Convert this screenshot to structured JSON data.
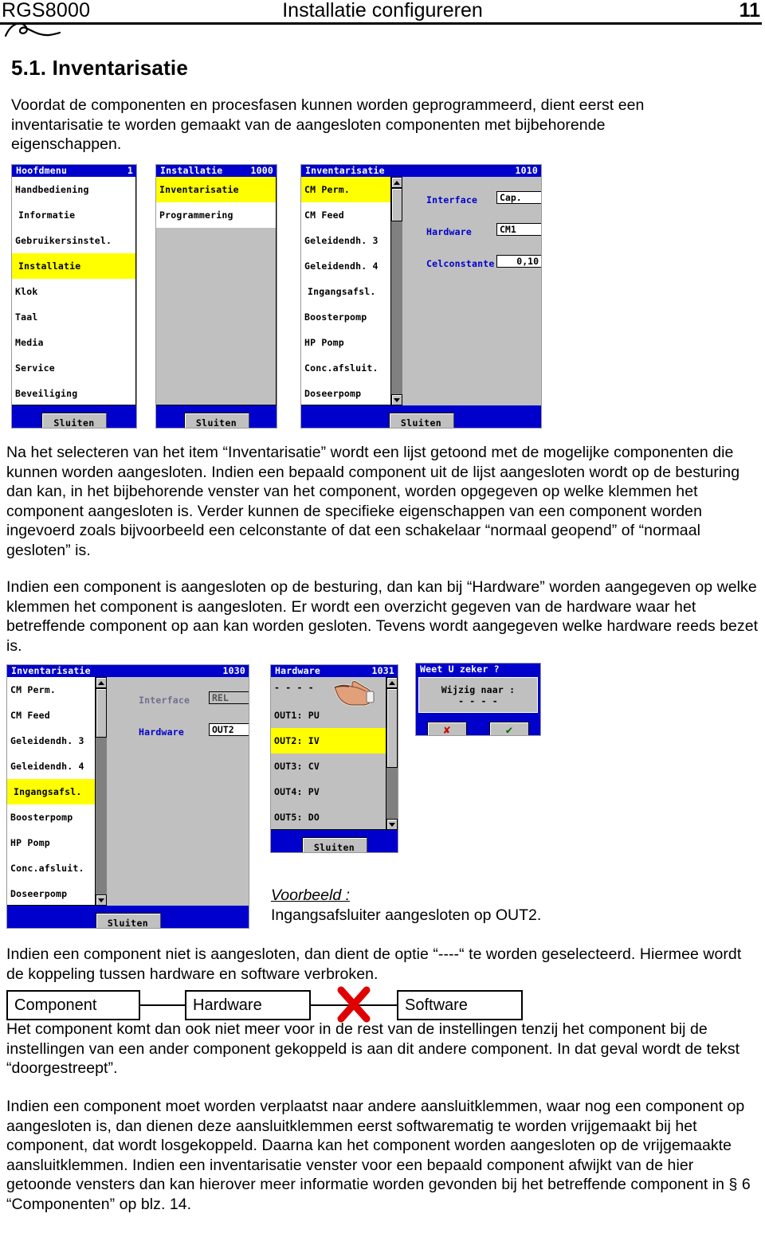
{
  "header": {
    "left": "RGS8000",
    "center": "Installatie configureren",
    "page": "11"
  },
  "section": {
    "heading": "5.1. Inventarisatie",
    "intro": "Voordat de componenten en procesfasen kunnen worden geprogrammeerd, dient eerst een inventarisatie te worden gemaakt van de aangesloten componenten met bijbehorende eigenschappen.",
    "para_a": "Na het selecteren van het item “Inventarisatie” wordt een lijst getoond met de mogelijke componenten die kunnen worden aangesloten. Indien een bepaald component uit de lijst aangesloten wordt op de besturing dan kan, in het bijbehorende venster van het component, worden opgegeven op welke klemmen het component aangesloten is. Verder kunnen de specifieke eigenschappen van een component worden ingevoerd zoals bijvoorbeeld een celconstante of dat een schakelaar “normaal geopend” of “normaal gesloten” is.",
    "para_b": "Indien een component is aangesloten op de besturing, dan kan bij “Hardware” worden aangegeven op welke klemmen het component is aangesloten. Er wordt een overzicht gegeven van de hardware waar het betreffende component op aan kan worden gesloten. Tevens wordt aangegeven welke hardware reeds bezet is.",
    "para_c": "Indien een component niet is aangesloten, dan dient de optie “----“ te worden geselecteerd. Hiermee wordt de koppeling tussen hardware en software verbroken.",
    "para_d": "Het component komt dan ook niet meer voor in de rest van de instellingen tenzij het component bij de instellingen van een ander component gekoppeld is aan dit andere component. In dat geval wordt de tekst “doorgestreept”.",
    "para_e": "Indien een component moet worden verplaatst naar andere aansluitklemmen, waar nog een component op aangesloten is, dan dienen deze aansluitklemmen eerst softwarematig te worden vrijgemaakt bij het component, dat wordt losgekoppeld. Daarna kan het component worden aangesloten op de vrijgemaakte aansluitklemmen. Indien een inventarisatie venster voor een bepaald component afwijkt van de hier getoonde vensters dan kan hierover meer informatie worden gevonden bij het betreffende component in § 6 “Componenten” op blz. 14."
  },
  "example": {
    "title": "Voorbeeld :",
    "text": "Ingangsafsluiter aangesloten op OUT2."
  },
  "diagram": {
    "component": "Component",
    "hardware": "Hardware",
    "software": "Software"
  },
  "close_label": "Sluiten",
  "dialogs": {
    "hoofdmenu": {
      "title": "Hoofdmenu",
      "code": "1",
      "items": [
        {
          "label": "Handbediening",
          "selected": false
        },
        {
          "label": "Informatie",
          "selected": false
        },
        {
          "label": "Gebruikersinstel.",
          "selected": false
        },
        {
          "label": "Installatie",
          "selected": true
        },
        {
          "label": "Klok",
          "selected": false
        },
        {
          "label": "Taal",
          "selected": false
        },
        {
          "label": "Media",
          "selected": false
        },
        {
          "label": "Service",
          "selected": false
        },
        {
          "label": "Beveiliging",
          "selected": false
        }
      ]
    },
    "installatie": {
      "title": "Installatie",
      "code": "1000",
      "items": [
        {
          "label": "Inventarisatie",
          "selected": true
        },
        {
          "label": "Programmering",
          "selected": false
        }
      ]
    },
    "inventarisatie_1010": {
      "title": "Inventarisatie",
      "code": "1010",
      "items": [
        {
          "label": "CM Perm.",
          "selected": true
        },
        {
          "label": "CM Feed",
          "selected": false
        },
        {
          "label": "Geleidendh. 3",
          "selected": false
        },
        {
          "label": "Geleidendh. 4",
          "selected": false
        },
        {
          "label": "Ingangsafsl.",
          "selected": false
        },
        {
          "label": "Boosterpomp",
          "selected": false
        },
        {
          "label": "HP Pomp",
          "selected": false
        },
        {
          "label": "Conc.afsluit.",
          "selected": false
        },
        {
          "label": "Doseerpomp",
          "selected": false
        }
      ],
      "fields": {
        "interface_label": "Interface",
        "interface_value": "Cap.",
        "hardware_label": "Hardware",
        "hardware_value": "CM1",
        "celconstante_label": "Celconstante",
        "celconstante_value": "0,10"
      }
    },
    "inventarisatie_1030": {
      "title": "Inventarisatie",
      "code": "1030",
      "items": [
        {
          "label": "CM Perm.",
          "selected": false
        },
        {
          "label": "CM Feed",
          "selected": false
        },
        {
          "label": "Geleidendh. 3",
          "selected": false
        },
        {
          "label": "Geleidendh. 4",
          "selected": false
        },
        {
          "label": "Ingangsafsl.",
          "selected": true
        },
        {
          "label": "Boosterpomp",
          "selected": false
        },
        {
          "label": "HP Pomp",
          "selected": false
        },
        {
          "label": "Conc.afsluit.",
          "selected": false
        },
        {
          "label": "Doseerpomp",
          "selected": false
        }
      ],
      "fields": {
        "interface_label": "Interface",
        "interface_value": "REL",
        "hardware_label": "Hardware",
        "hardware_value": "OUT2"
      }
    },
    "hardware_1031": {
      "title": "Hardware",
      "code": "1031",
      "items": [
        {
          "label": "- - - -",
          "selected": false
        },
        {
          "label": "OUT1: PU",
          "selected": false
        },
        {
          "label": "OUT2: IV",
          "selected": true
        },
        {
          "label": "OUT3: CV",
          "selected": false
        },
        {
          "label": "OUT4: PV",
          "selected": false
        },
        {
          "label": "OUT5: DO",
          "selected": false
        }
      ]
    },
    "confirm": {
      "title": "Weet U zeker ?",
      "message_line1": "Wijzig naar :",
      "message_line2": "- - - -",
      "no_label": "✘",
      "yes_label": "✔"
    }
  },
  "colors": {
    "dialog_blue": "#0000cc",
    "selection_yellow": "#ffff00",
    "panel_gray": "#c0c0c0",
    "cross_red": "#e00000"
  }
}
